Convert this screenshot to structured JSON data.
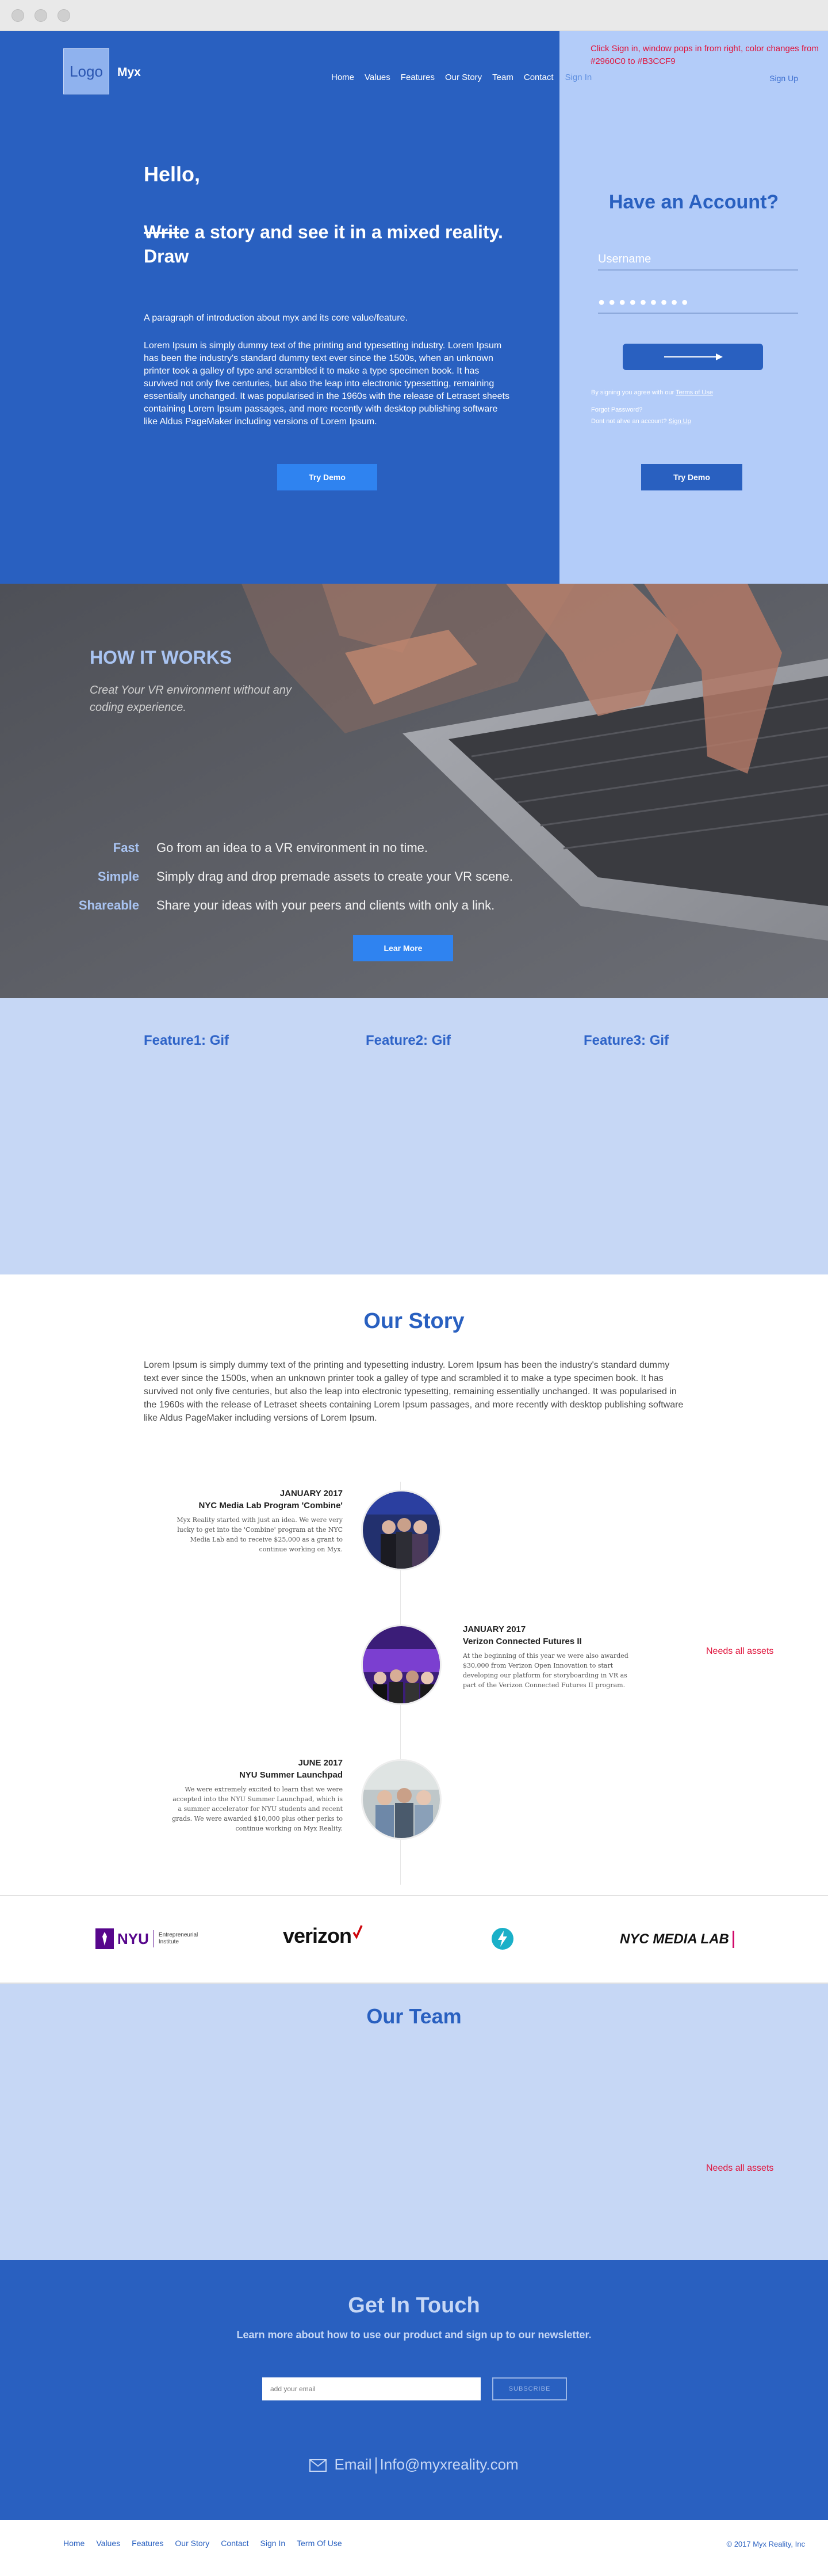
{
  "note": "Click Sign in, window pops in from right, color changes from #2960C0 to #B3CCF9",
  "header": {
    "logo": "Logo",
    "brand": "Myx",
    "nav": [
      "Home",
      "Values",
      "Features",
      "Our Story",
      "Team",
      "Contact"
    ],
    "sign_in": "Sign In",
    "sign_up": "Sign Up"
  },
  "hero": {
    "hello": "Hello,",
    "strike_word": "Writ",
    "headline_rest": "e a story and see it in a mixed reality. Draw",
    "intro": "A paragraph of introduction about myx and its core value/feature.",
    "lorem": "Lorem Ipsum is simply dummy text of the printing and typesetting industry. Lorem Ipsum has been the industry's standard dummy text ever since the 1500s, when an unknown printer took a galley of type and scrambled it to make a type specimen book. It has survived not only five centuries, but also the leap into electronic typesetting, remaining essentially unchanged. It was popularised in the 1960s with the release of Letraset sheets containing Lorem Ipsum passages, and more recently with desktop publishing software like Aldus PageMaker including versions of Lorem Ipsum.",
    "try_demo": "Try Demo"
  },
  "account": {
    "title": "Have an Account?",
    "username_placeholder": "Username",
    "password_mask": "●●●●●●●●●",
    "terms_prefix": "By signing you agree with our ",
    "terms_link": "Terms of Use",
    "forgot": "Forgot Password?",
    "no_account_prefix": "Dont not ahve an account? ",
    "sign_up_link": "Sign Up",
    "try_demo": "Try Demo"
  },
  "how": {
    "title": "HOW IT WORKS",
    "subtitle": "Creat Your VR environment without any coding experience.",
    "items": [
      {
        "key": "Fast",
        "value": "Go from an idea to a VR environment in no time."
      },
      {
        "key": "Simple",
        "value": "Simply drag and drop premade assets to create your VR scene."
      },
      {
        "key": "Shareable",
        "value": "Share your ideas with your peers and clients with only a link."
      }
    ],
    "button": "Lear More"
  },
  "features": [
    "Feature1: Gif",
    "Feature2: Gif",
    "Feature3: Gif"
  ],
  "story": {
    "title": "Our Story",
    "lorem": "Lorem Ipsum is simply dummy text of the printing and typesetting industry. Lorem Ipsum has been the industry's standard dummy text ever since the 1500s, when an unknown printer took a galley of type and scrambled it to make a type specimen book. It has survived not only five centuries, but also the leap into electronic typesetting, remaining essentially unchanged. It was popularised in the 1960s with the release of Letraset sheets containing Lorem Ipsum passages, and more recently with desktop publishing software like Aldus PageMaker including versions of Lorem Ipsum.",
    "timeline": [
      {
        "date": "JANUARY 2017",
        "heading": "NYC Media Lab Program 'Combine'",
        "body": "Myx Reality started with just an idea. We were very lucky to get into the 'Combine' program at the NYC Media Lab and to receive $25,000 as a grant to continue working on Myx."
      },
      {
        "date": "JANUARY 2017",
        "heading": "Verizon Connected Futures II",
        "body": "At the beginning of this year we were also awarded $30,000 from Verizon Open Innovation to start developing our platform for storyboarding in VR as part of the Verizon Connected Futures II program."
      },
      {
        "date": "JUNE 2017",
        "heading": "NYU Summer Launchpad",
        "body": "We were extremely excited to learn that we were accepted into the NYU Summer Launchpad, which is a summer accelerator for NYU students and recent grads. We were awarded $10,000 plus other perks to continue working on Myx Reality."
      }
    ],
    "needs_all_assets": "Needs all assets"
  },
  "partners": {
    "nyu": "NYU",
    "nyu_sub": "Entrepreneurial Institute",
    "verizon": "verizon",
    "nycml": "NYC MEDIA LAB"
  },
  "team": {
    "title": "Our Team",
    "needs_all_assets": "Needs all assets"
  },
  "touch": {
    "title": "Get In Touch",
    "subtitle": "Learn more about how to use our product and sign up to our newsletter.",
    "email_placeholder": "add your email",
    "subscribe": "SUBSCRIBE",
    "email_label": "Email",
    "email": "Info@myxreality.com"
  },
  "footer": {
    "links": [
      "Home",
      "Values",
      "Features",
      "Our Story",
      "Contact",
      "Sign In",
      "Term Of Use"
    ],
    "copyright": "© 2017 Myx Reality, Inc"
  },
  "colors": {
    "primary": "#2960C0",
    "panel": "#B3CCF9",
    "light": "#C6D7F5",
    "accent_button": "#2F83F0",
    "note_red": "#e0143c"
  }
}
